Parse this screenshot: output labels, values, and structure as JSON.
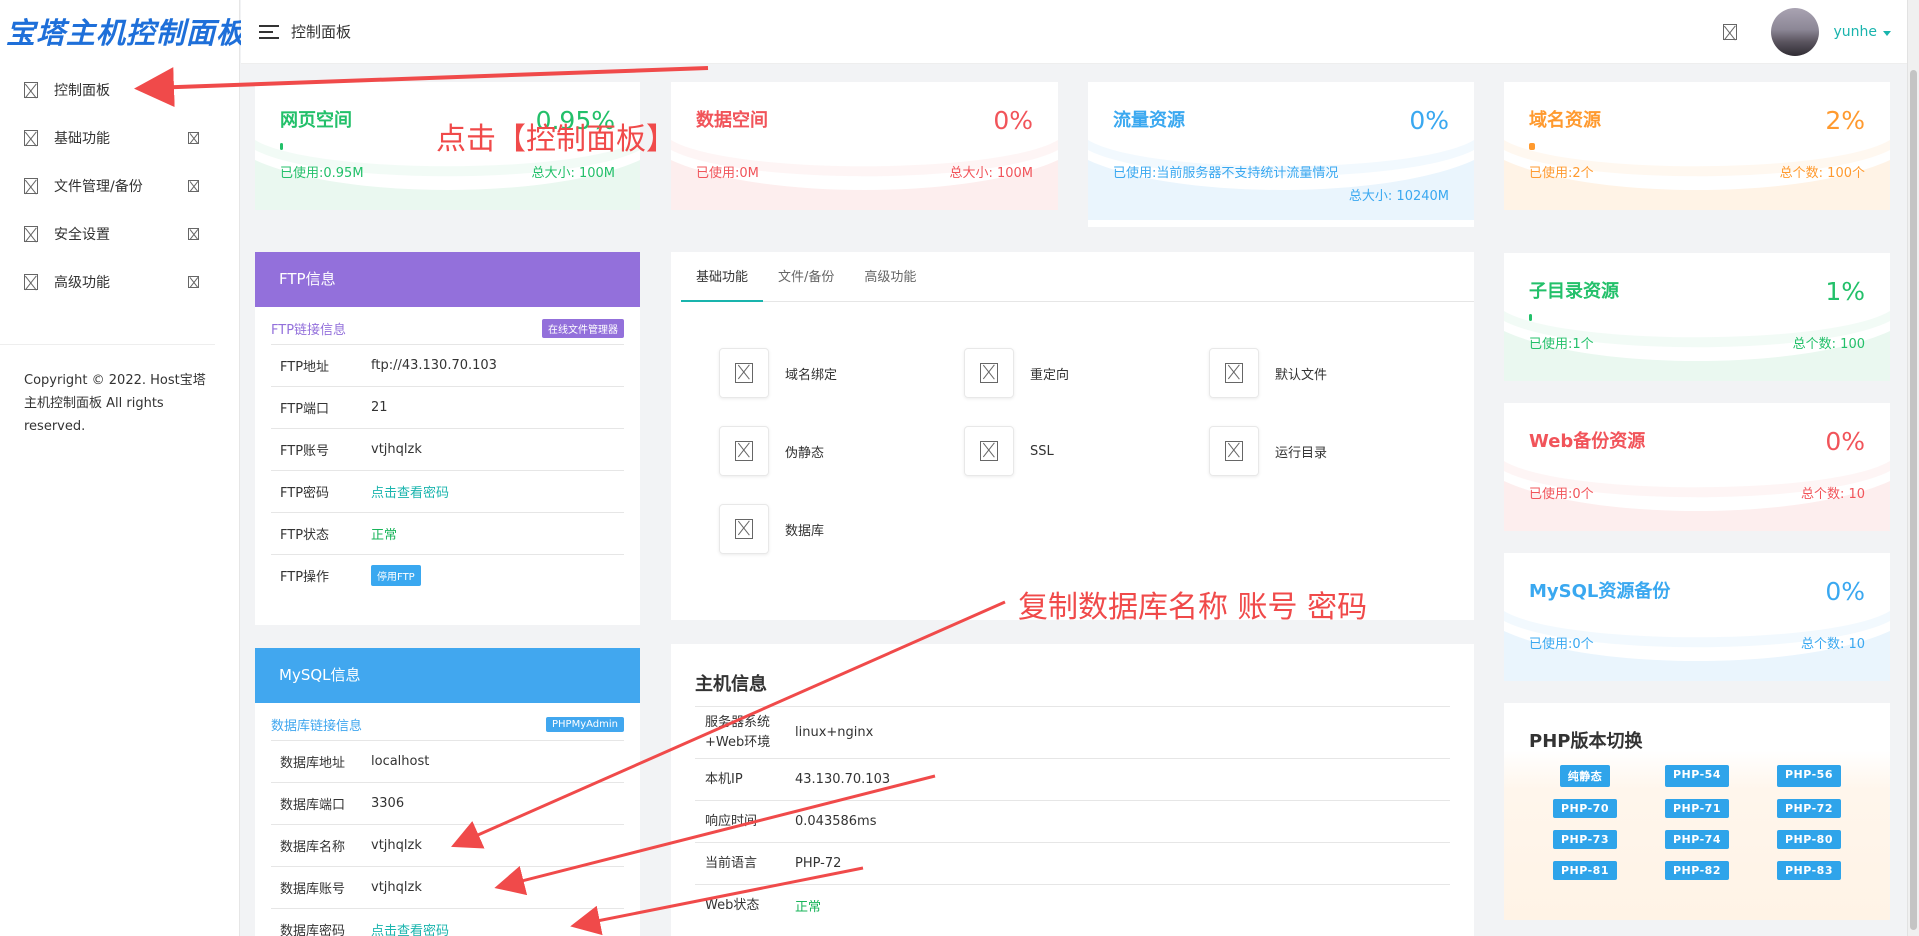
{
  "brand": "宝塔主机控制面板",
  "sidebar": {
    "items": [
      {
        "label": "控制面板",
        "icon": "dashboard-icon",
        "has_arrow": false
      },
      {
        "label": "基础功能",
        "icon": "basic-icon",
        "has_arrow": true
      },
      {
        "label": "文件管理/备份",
        "icon": "folder-icon",
        "has_arrow": true
      },
      {
        "label": "安全设置",
        "icon": "shield-icon",
        "has_arrow": true
      },
      {
        "label": "高级功能",
        "icon": "advanced-icon",
        "has_arrow": true
      }
    ],
    "copyright": "Copyright © 2022. Host宝塔主机控制面板 All rights reserved."
  },
  "header": {
    "title": "控制面板",
    "username": "yunhe"
  },
  "resources": [
    {
      "title": "网页空间",
      "percent": "0.95%",
      "used": "已使用:0.95M",
      "total": "总大小: 100M",
      "fill": 0.0095,
      "color": "#23c06a"
    },
    {
      "title": "数据空间",
      "percent": "0%",
      "used": "已使用:0M",
      "total": "总大小: 100M",
      "fill": 0,
      "color": "#f1545a"
    },
    {
      "title": "流量资源",
      "percent": "0%",
      "used": "已使用:当前服务器不支持统计流量情况",
      "total": "总大小: 10240M",
      "fill": 0,
      "color": "#3aa8f0"
    },
    {
      "title": "域名资源",
      "percent": "2%",
      "used": "已使用:2个",
      "total": "总个数: 100个",
      "fill": 0.02,
      "color": "#ff9a2f"
    },
    {
      "title": "子目录资源",
      "percent": "1%",
      "used": "已使用:1个",
      "total": "总个数: 100",
      "fill": 0.01,
      "color": "#23c06a"
    },
    {
      "title": "Web备份资源",
      "percent": "0%",
      "used": "已使用:0个",
      "total": "总个数: 10",
      "fill": 0,
      "color": "#f1545a"
    },
    {
      "title": "MySQL资源备份",
      "percent": "0%",
      "used": "已使用:0个",
      "total": "总个数: 10",
      "fill": 0,
      "color": "#3aa8f0"
    }
  ],
  "ftp": {
    "title": "FTP信息",
    "link_label": "FTP链接信息",
    "tag": "在线文件管理器",
    "rows": [
      {
        "k": "FTP地址",
        "v": "ftp://43.130.70.103"
      },
      {
        "k": "FTP端口",
        "v": "21"
      },
      {
        "k": "FTP账号",
        "v": "vtjhqlzk"
      },
      {
        "k": "FTP密码",
        "v": "点击查看密码"
      },
      {
        "k": "FTP状态",
        "v": "正常"
      },
      {
        "k": "FTP操作",
        "v": "停用FTP"
      }
    ]
  },
  "mysql": {
    "title": "MySQL信息",
    "link_label": "数据库链接信息",
    "tag": "PHPMyAdmin",
    "rows": [
      {
        "k": "数据库地址",
        "v": "localhost"
      },
      {
        "k": "数据库端口",
        "v": "3306"
      },
      {
        "k": "数据库名称",
        "v": "vtjhqlzk"
      },
      {
        "k": "数据库账号",
        "v": "vtjhqlzk"
      },
      {
        "k": "数据库密码",
        "v": "点击查看密码"
      }
    ]
  },
  "features": {
    "tabs": [
      "基础功能",
      "文件/备份",
      "高级功能"
    ],
    "items": [
      {
        "label": "域名绑定",
        "icon": "domain-icon"
      },
      {
        "label": "重定向",
        "icon": "redirect-icon"
      },
      {
        "label": "默认文件",
        "icon": "default-file-icon"
      },
      {
        "label": "伪静态",
        "icon": "rewrite-icon"
      },
      {
        "label": "SSL",
        "icon": "ssl-icon"
      },
      {
        "label": "运行目录",
        "icon": "run-dir-icon"
      },
      {
        "label": "数据库",
        "icon": "database-icon"
      }
    ]
  },
  "host": {
    "title": "主机信息",
    "rows": [
      {
        "k": "服务器系统+Web环境",
        "v": "linux+nginx"
      },
      {
        "k": "本机IP",
        "v": "43.130.70.103"
      },
      {
        "k": "响应时间",
        "v": "0.043586ms"
      },
      {
        "k": "当前语言",
        "v": "PHP-72"
      },
      {
        "k": "Web状态",
        "v": "正常"
      }
    ]
  },
  "php": {
    "title": "PHP版本切换",
    "versions": [
      "纯静态",
      "PHP-54",
      "PHP-56",
      "PHP-70",
      "PHP-71",
      "PHP-72",
      "PHP-73",
      "PHP-74",
      "PHP-80",
      "PHP-81",
      "PHP-82",
      "PHP-83"
    ]
  },
  "annotations": {
    "click_panel": "点击【控制面板】",
    "copy_db": "复制数据库名称 账号 密码"
  },
  "colors": {
    "ftp_head": "#9370db",
    "mysql_head": "#41a7ef",
    "accent": "#19b4ad",
    "annotation": "#f04a4a"
  }
}
